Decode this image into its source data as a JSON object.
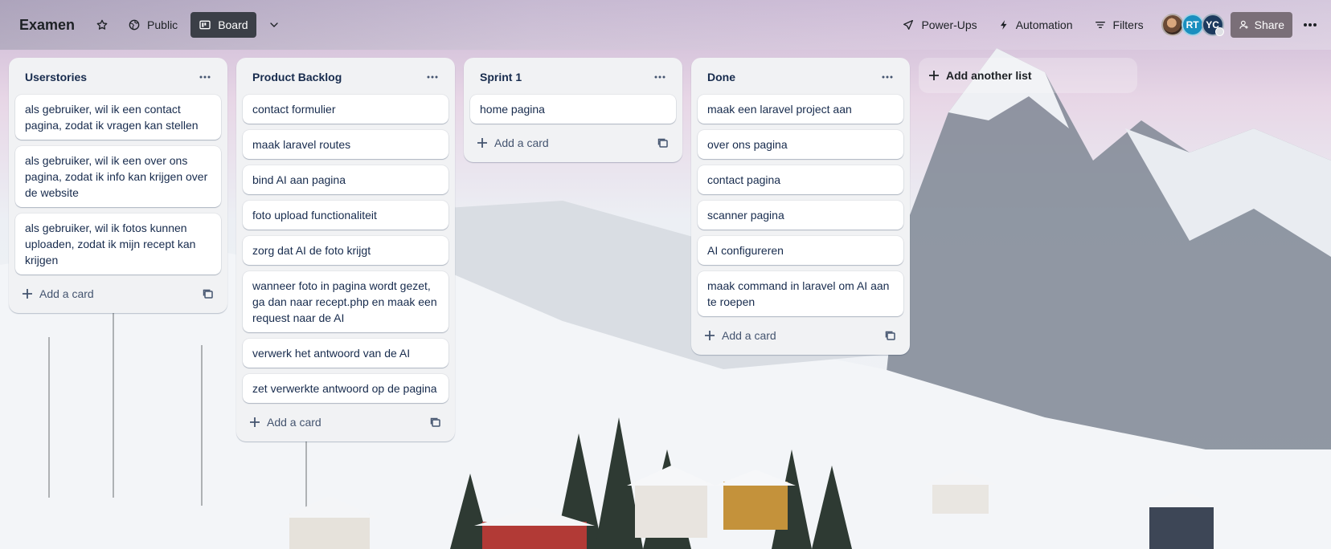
{
  "board": {
    "title": "Examen",
    "visibility_label": "Public",
    "view_label": "Board"
  },
  "header_right": {
    "powerups_label": "Power-Ups",
    "automation_label": "Automation",
    "filters_label": "Filters",
    "avatars": [
      {
        "initials": ""
      },
      {
        "initials": "RT"
      },
      {
        "initials": "YC"
      }
    ],
    "share_label": "Share"
  },
  "lists": [
    {
      "title": "Userstories",
      "cards": [
        "als gebruiker, wil ik een contact pagina, zodat ik vragen kan stellen",
        "als gebruiker, wil ik een over ons pagina, zodat ik info kan krijgen over de website",
        "als gebruiker, wil ik fotos kunnen uploaden, zodat ik mijn recept kan krijgen"
      ],
      "add_card_label": "Add a card"
    },
    {
      "title": "Product Backlog",
      "cards": [
        "contact formulier",
        "maak laravel routes",
        "bind AI aan pagina",
        "foto upload functionaliteit",
        "zorg dat AI de foto krijgt",
        "wanneer foto in pagina wordt gezet, ga dan naar recept.php en maak een request naar de AI",
        "verwerk het antwoord van de AI",
        "zet verwerkte antwoord op de pagina"
      ],
      "add_card_label": "Add a card"
    },
    {
      "title": "Sprint 1",
      "cards": [
        "home pagina"
      ],
      "add_card_label": "Add a card"
    },
    {
      "title": "Done",
      "cards": [
        "maak een laravel project aan",
        "over ons pagina",
        "contact pagina",
        "scanner pagina",
        "AI configureren",
        "maak command in laravel om AI aan te roepen"
      ],
      "add_card_label": "Add a card"
    }
  ],
  "add_list_label": "Add another list",
  "icons": {
    "star": "star-icon",
    "globe": "globe-icon",
    "board": "board-icon",
    "chevron": "chevron-down-icon",
    "rocket": "rocket-icon",
    "bolt": "bolt-icon",
    "filter": "filter-icon",
    "person": "person-add-icon",
    "more": "more-icon",
    "plus": "plus-icon",
    "template": "template-icon"
  },
  "colors": {
    "active_view_bg": "#3b3f47",
    "share_bg": "#7a6f78",
    "list_bg": "#f1f2f4",
    "avatar_rt": "#1a8fbf",
    "avatar_yc": "#1c3a5e"
  }
}
